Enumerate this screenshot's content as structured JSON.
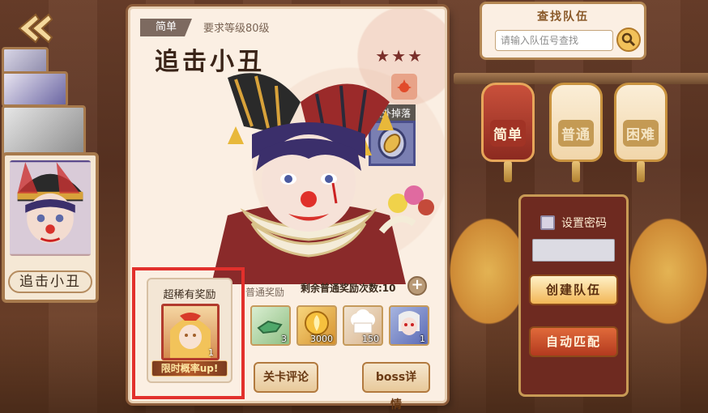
{
  "back": {
    "icon": "back-arrow-icon"
  },
  "boss_list": {
    "selected_name": "追击小丑"
  },
  "card": {
    "difficulty_tag": "简单",
    "requirement": "要求等级80级",
    "boss_name": "追击小丑",
    "stars": [
      "★",
      "★",
      "★"
    ],
    "element_icon": "fire-element-icon",
    "extra_drop_label": "额外掉落",
    "extra_drop_icon": "gem-medal-icon",
    "normal_reward_label": "普通奖励",
    "remaining_rewards_text": "剩余普通奖励次数:10",
    "plus_label": "+",
    "rewards": [
      {
        "icon": "green-crystal-icon",
        "qty": "3"
      },
      {
        "icon": "gold-coin-icon",
        "qty": "3000"
      },
      {
        "icon": "chef-hat-icon",
        "qty": "150"
      },
      {
        "icon": "character-portrait-icon",
        "qty": "1"
      }
    ],
    "review_button": "关卡评论",
    "boss_detail_button": "boss详情",
    "super_rare": {
      "title": "超稀有奖励",
      "qty": "1",
      "banner": "限时概率up!"
    }
  },
  "search": {
    "title": "查找队伍",
    "placeholder": "请输入队伍号查找"
  },
  "difficulties": [
    {
      "label": "简单",
      "active": true
    },
    {
      "label": "普通",
      "active": false
    },
    {
      "label": "困难",
      "active": false
    }
  ],
  "team": {
    "password_label": "设置密码",
    "create_button": "创建队伍",
    "auto_match_button": "自动匹配"
  },
  "colors": {
    "accent_red": "#e2302c",
    "card_bg": "#fbefe3",
    "panel_dark_red": "#6e2a20"
  }
}
